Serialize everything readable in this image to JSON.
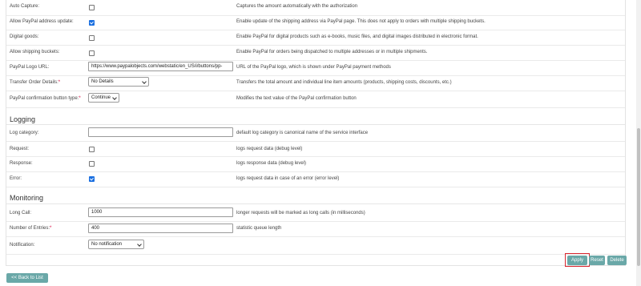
{
  "paypal_settings": {
    "auto_capture": {
      "label": "Auto Capture:",
      "checked": false,
      "description": "Captures the amount automatically with the authorization"
    },
    "address_update": {
      "label": "Allow PayPal address update:",
      "checked": true,
      "description": "Enable update of the shipping address via PayPal page. This does not apply to orders with multiple shipping buckets."
    },
    "digital_goods": {
      "label": "Digital goods:",
      "checked": false,
      "description": "Enable PayPal for digital products such as e-books, music files, and digital images distributed in electronic format."
    },
    "shipping_buckets": {
      "label": "Allow shipping buckets:",
      "checked": false,
      "description": "Enable PayPal for orders being dispatched to multiple addresses or in multiple shipments."
    },
    "logo_url": {
      "label": "PayPal Logo URL:",
      "value": "https://www.paypalobjects.com/webstatic/en_US/i/buttons/pp-",
      "description": "URL of the PayPal logo, which is shown under PayPal payment methods"
    },
    "transfer_order": {
      "label": "Transfer Order Details:",
      "required_mark": "*",
      "value": "No Details",
      "description": "Transfers the total amount and individual line item amounts (products, shipping costs, discounts, etc.)"
    },
    "confirmation_button": {
      "label": "PayPal confirmation button type:",
      "required_mark": "*",
      "value": "Continue",
      "description": "Modifies the text value of the PayPal confirmation button"
    }
  },
  "logging": {
    "title": "Logging",
    "category": {
      "label": "Log category:",
      "value": "",
      "description": "default log category is canonical name of the service interface"
    },
    "request": {
      "label": "Request:",
      "checked": false,
      "description": "logs request data (debug level)"
    },
    "response": {
      "label": "Response:",
      "checked": false,
      "description": "logs response data (debug level)"
    },
    "error": {
      "label": "Error:",
      "checked": true,
      "description": "logs request data in case of an error (error level)"
    }
  },
  "monitoring": {
    "title": "Monitoring",
    "long_call": {
      "label": "Long Call:",
      "value": "1000",
      "description": "longer requests will be marked as long calls (in milliseconds)"
    },
    "entries": {
      "label": "Number of Entries:",
      "required_mark": "*",
      "value": "400",
      "description": "statistic queue length"
    },
    "notification": {
      "label": "Notification:",
      "value": "No notification"
    }
  },
  "actions": {
    "apply": "Apply",
    "reset": "Reset",
    "delete": "Delete"
  },
  "footer": {
    "back_to_list": "<< Back to List"
  },
  "colors": {
    "button": "#6aa8a8",
    "required": "#d9003a",
    "highlight_border": "#d9262f",
    "checkbox_checked": "#1a6fe0"
  }
}
